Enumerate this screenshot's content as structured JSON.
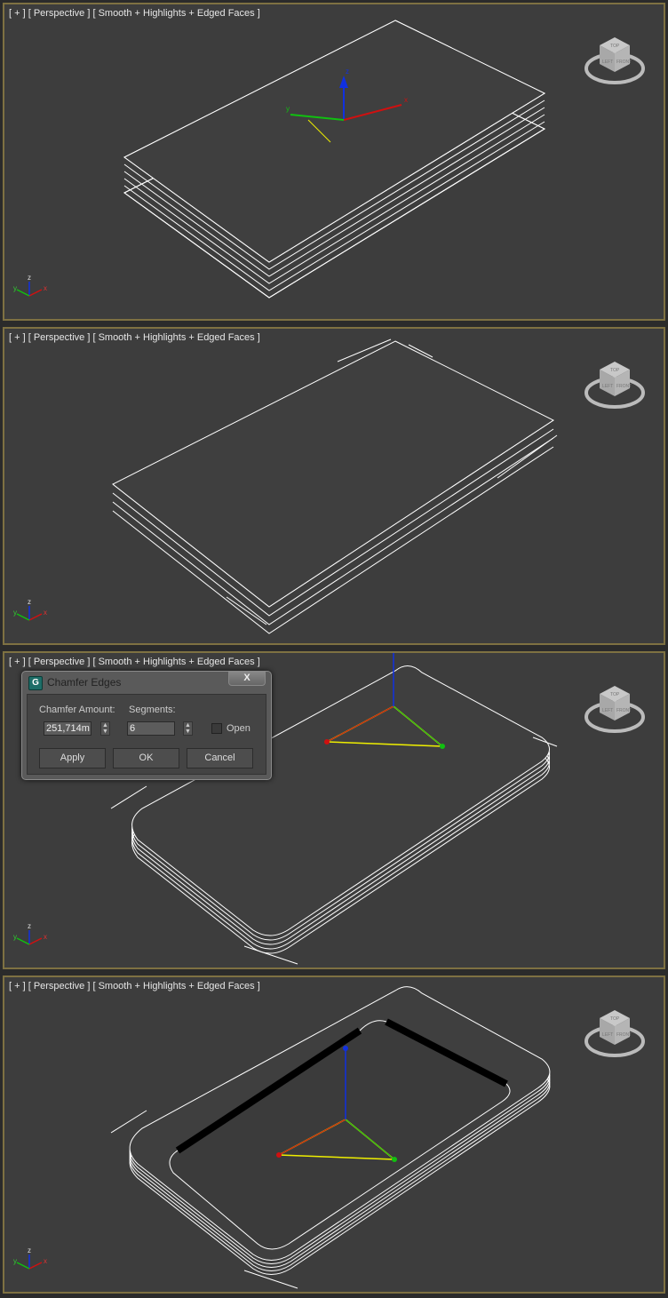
{
  "viewports": [
    {
      "label": "[ + ] [ Perspective ] [ Smooth + Highlights + Edged Faces ]"
    },
    {
      "label": "[ + ] [ Perspective ] [ Smooth + Highlights + Edged Faces ]"
    },
    {
      "label": "[ + ] [ Perspective ] [ Smooth + Highlights + Edged Faces ]"
    },
    {
      "label": "[ + ] [ Perspective ] [ Smooth + Highlights + Edged Faces ]"
    }
  ],
  "axes": {
    "x": "x",
    "y": "y",
    "z": "z"
  },
  "viewcube": {
    "top": "TOP",
    "front": "FRONT",
    "left": "LEFT"
  },
  "dialog": {
    "title": "Chamfer Edges",
    "close": "X",
    "chamfer_amount_label": "Chamfer Amount:",
    "chamfer_amount_value": "251,714m",
    "segments_label": "Segments:",
    "segments_value": "6",
    "open_label": "Open",
    "apply": "Apply",
    "ok": "OK",
    "cancel": "Cancel"
  },
  "colors": {
    "viewport_border": "#7e7142",
    "viewport_bg": "#3d3d3d",
    "x_axis": "#d01010",
    "y_axis": "#10c010",
    "z_axis": "#1030e0"
  }
}
